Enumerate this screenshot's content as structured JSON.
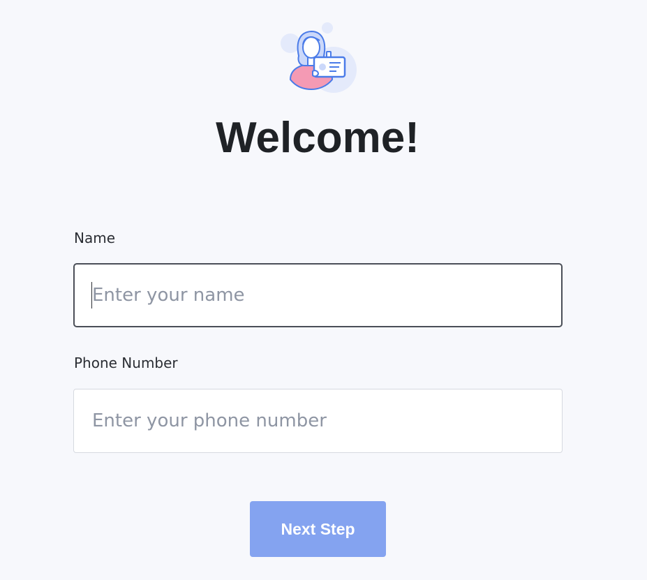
{
  "header": {
    "illustration_icon": "person-with-id-card-icon",
    "title": "Welcome!"
  },
  "form": {
    "name": {
      "label": "Name",
      "placeholder": "Enter your name",
      "value": "",
      "focused": true
    },
    "phone": {
      "label": "Phone Number",
      "placeholder": "Enter your phone number",
      "value": ""
    },
    "submit_label": "Next Step"
  },
  "colors": {
    "background": "#f7f8fc",
    "title_text": "#1f2226",
    "button_background": "#84a3f0",
    "button_text": "#ffffff",
    "placeholder_text": "#8e95a3",
    "focused_border": "#4a4e57",
    "input_border": "#d6d9e0",
    "illustration_blue": "#4a7be8",
    "illustration_pink": "#f49ab4"
  }
}
